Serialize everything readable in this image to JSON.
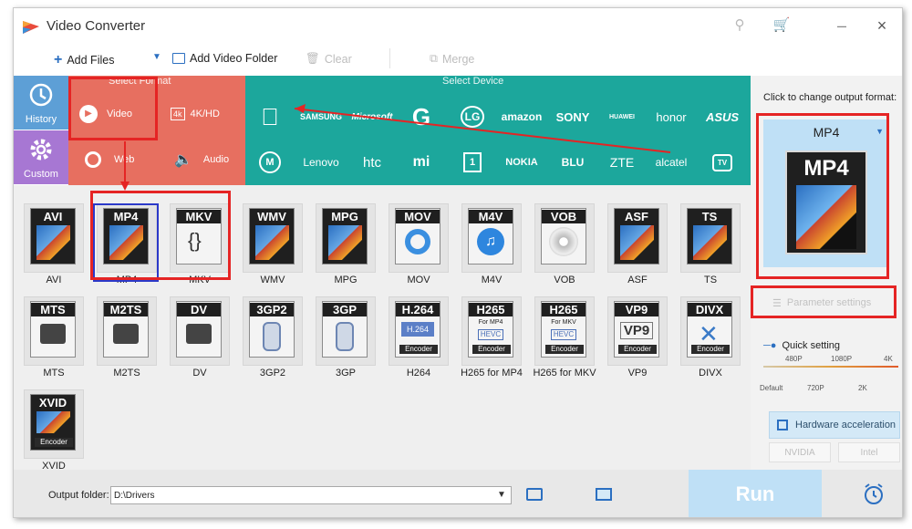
{
  "window": {
    "title": "Video Converter"
  },
  "toolbar": {
    "add_files": "Add Files",
    "add_folder": "Add Video Folder",
    "clear": "Clear",
    "merge": "Merge"
  },
  "nav": {
    "history": "History",
    "custom": "Custom"
  },
  "format_section": {
    "header": "Select Format",
    "items": [
      {
        "label": "Video",
        "icon": "play-icon"
      },
      {
        "label": "4K/HD",
        "icon": "4k-icon"
      },
      {
        "label": "Web",
        "icon": "chrome-icon"
      },
      {
        "label": "Audio",
        "icon": "speaker-icon"
      }
    ]
  },
  "device_section": {
    "header": "Select Device",
    "row1": [
      "",
      "SAMSUNG",
      "Microsoft",
      "G",
      "LG",
      "amazon",
      "SONY",
      "HUAWEI",
      "honor",
      "ASUS"
    ],
    "row2": [
      "",
      "Lenovo",
      "htc",
      "mi",
      "",
      "NOKIA",
      "BLU",
      "ZTE",
      "alcatel",
      "TV"
    ]
  },
  "formats": [
    {
      "label": "AVI",
      "name": "AVI"
    },
    {
      "label": "MP4",
      "name": "MP4"
    },
    {
      "label": "MKV",
      "name": "MKV"
    },
    {
      "label": "WMV",
      "name": "WMV"
    },
    {
      "label": "MPG",
      "name": "MPG"
    },
    {
      "label": "MOV",
      "name": "MOV"
    },
    {
      "label": "M4V",
      "name": "M4V"
    },
    {
      "label": "VOB",
      "name": "VOB"
    },
    {
      "label": "ASF",
      "name": "ASF"
    },
    {
      "label": "TS",
      "name": "TS"
    },
    {
      "label": "MTS",
      "name": "MTS"
    },
    {
      "label": "M2TS",
      "name": "M2TS"
    },
    {
      "label": "DV",
      "name": "DV"
    },
    {
      "label": "3GP2",
      "name": "3GP2"
    },
    {
      "label": "3GP",
      "name": "3GP"
    },
    {
      "label": "H.264",
      "name": "H264",
      "sub": "H.264",
      "enc": "Encoder"
    },
    {
      "label": "H265",
      "name": "H265 for MP4",
      "sub": "For MP4",
      "sub2": "HEVC",
      "enc": "Encoder"
    },
    {
      "label": "H265",
      "name": "H265 for MKV",
      "sub": "For MKV",
      "sub2": "HEVC",
      "enc": "Encoder"
    },
    {
      "label": "VP9",
      "name": "VP9",
      "sub": "VP9",
      "enc": "Encoder"
    },
    {
      "label": "DIVX",
      "name": "DIVX",
      "enc": "Encoder"
    },
    {
      "label": "XVID",
      "name": "XVID",
      "enc": "Encoder"
    }
  ],
  "right_panel": {
    "change_label": "Click to change output format:",
    "output_format": "MP4",
    "output_icon_label": "MP4",
    "param_settings": "Parameter settings",
    "quick_setting": "Quick setting",
    "ticks_top": [
      "480P",
      "1080P",
      "4K"
    ],
    "ticks_bottom": [
      "Default",
      "720P",
      "2K"
    ],
    "hw_accel": "Hardware acceleration",
    "gpu": [
      "NVIDIA",
      "Intel"
    ]
  },
  "bottom": {
    "output_label": "Output folder:",
    "output_path": "D:\\Drivers",
    "run": "Run"
  },
  "colors": {
    "format_block": "#e76f60",
    "device_block": "#1ca79c",
    "history": "#5d9fd6",
    "custom": "#a777d3",
    "annotation": "#e52424"
  }
}
